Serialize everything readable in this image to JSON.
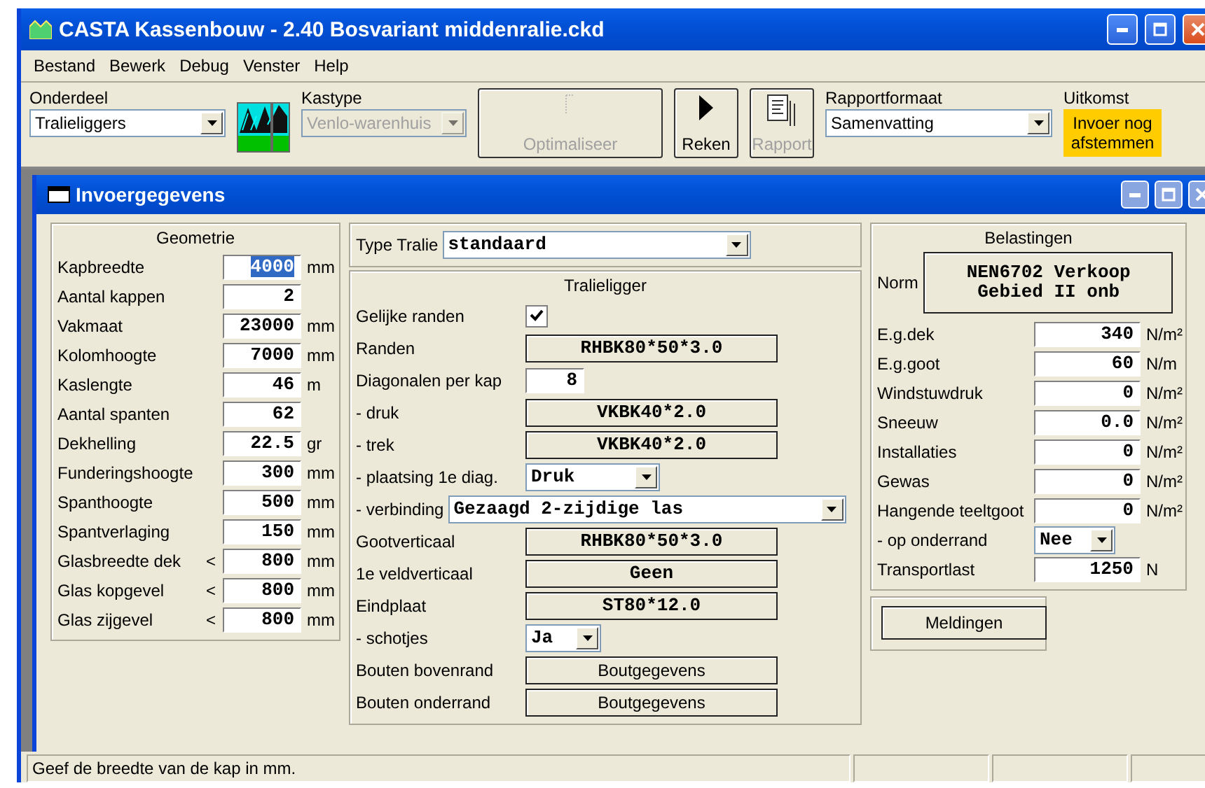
{
  "window": {
    "title": "CASTA Kassenbouw - 2.40 Bosvariant middenralie.ckd"
  },
  "menu": [
    "Bestand",
    "Bewerk",
    "Debug",
    "Venster",
    "Help"
  ],
  "toolbar": {
    "onderdeel": {
      "label": "Onderdeel",
      "value": "Tralieliggers"
    },
    "kastype": {
      "label": "Kastype",
      "value": "Venlo-warenhuis",
      "disabled": true
    },
    "buttons": [
      {
        "kind": "optimize",
        "label": "Optimaliseer",
        "disabled": true
      },
      {
        "kind": "run",
        "label": "Reken",
        "disabled": false
      },
      {
        "kind": "report",
        "label": "Rapport",
        "disabled": true
      }
    ],
    "rapportformaat": {
      "label": "Rapportformaat",
      "value": "Samenvatting"
    },
    "uitkomst": {
      "label": "Uitkomst",
      "lines": [
        "Invoer nog",
        "afstemmen"
      ],
      "color": "#ffcc00"
    }
  },
  "invoer": {
    "title": "Invoergegevens",
    "geometrie": {
      "title": "Geometrie",
      "rows": [
        {
          "label": "Kapbreedte",
          "value": "4000",
          "unit": "mm",
          "selected": true
        },
        {
          "label": "Aantal kappen",
          "value": "2",
          "selected": false
        },
        {
          "label": "Vakmaat",
          "value": "23000",
          "unit": "mm",
          "selected": false
        },
        {
          "label": "Kolomhoogte",
          "value": "7000",
          "unit": "mm",
          "selected": false
        },
        {
          "label": "Kaslengte",
          "value": "46",
          "unit": "m",
          "selected": false
        },
        {
          "label": "Aantal spanten",
          "value": "62",
          "selected": false
        },
        {
          "label": "Dekhelling",
          "value": "22.5",
          "unit": "gr",
          "selected": false
        },
        {
          "label": "Funderingshoogte",
          "value": "300",
          "unit": "mm",
          "selected": false
        },
        {
          "label": "Spanthoogte",
          "value": "500",
          "unit": "mm",
          "selected": false
        },
        {
          "label": "Spantverlaging",
          "value": "150",
          "unit": "mm",
          "selected": false
        },
        {
          "label": "Glasbreedte dek",
          "prefix": "<",
          "value": "800",
          "unit": "mm",
          "selected": false
        },
        {
          "label": "Glas kopgevel",
          "prefix": "<",
          "value": "800",
          "unit": "mm",
          "selected": false
        },
        {
          "label": "Glas zijgevel",
          "prefix": "<",
          "value": "800",
          "unit": "mm",
          "selected": false
        }
      ]
    },
    "type_tralie": {
      "label": "Type Tralie",
      "value": "standaard"
    },
    "tralieligger": {
      "title": "Tralieligger",
      "rows": [
        {
          "kind": "checkbox",
          "label": "Gelijke randen",
          "checked": true
        },
        {
          "kind": "button",
          "label": "Randen",
          "value": "RHBK80*50*3.0"
        },
        {
          "kind": "input",
          "label": "Diagonalen per kap",
          "value": "8"
        },
        {
          "kind": "button",
          "label": "- druk",
          "value": "VKBK40*2.0"
        },
        {
          "kind": "button",
          "label": "- trek",
          "value": "VKBK40*2.0"
        },
        {
          "kind": "select",
          "label": "- plaatsing 1e diag.",
          "value": "Druk"
        },
        {
          "kind": "wide_select",
          "label": "- verbinding",
          "value": "Gezaagd 2-zijdige las"
        },
        {
          "kind": "button",
          "label": "Gootverticaal",
          "value": "RHBK80*50*3.0"
        },
        {
          "kind": "button",
          "label": "1e veldverticaal",
          "value": "Geen"
        },
        {
          "kind": "button",
          "label": "Eindplaat",
          "value": "ST80*12.0"
        },
        {
          "kind": "small_select",
          "label": "- schotjes",
          "value": "Ja"
        },
        {
          "kind": "plain_button",
          "label": "Bouten bovenrand",
          "value": "Boutgegevens"
        },
        {
          "kind": "plain_button",
          "label": "Bouten onderrand",
          "value": "Boutgegevens"
        }
      ]
    },
    "belastingen": {
      "title": "Belastingen",
      "norm_label": "Norm",
      "norm_lines": [
        "NEN6702 Verkoop",
        "Gebied II onb"
      ],
      "rows": [
        {
          "kind": "input",
          "label": "E.g.dek",
          "value": "340",
          "unit": "N/m²"
        },
        {
          "kind": "input",
          "label": "E.g.goot",
          "value": "60",
          "unit": "N/m"
        },
        {
          "kind": "input",
          "label": "Windstuwdruk",
          "value": "0",
          "unit": "N/m²"
        },
        {
          "kind": "input",
          "label": "Sneeuw",
          "value": "0.0",
          "unit": "N/m²"
        },
        {
          "kind": "input",
          "label": "Installaties",
          "value": "0",
          "unit": "N/m²"
        },
        {
          "kind": "input",
          "label": "Gewas",
          "value": "0",
          "unit": "N/m²"
        },
        {
          "kind": "input",
          "label": "Hangende teeltgoot",
          "value": "0",
          "unit": "N/m²"
        },
        {
          "kind": "select",
          "label": "- op onderrand",
          "value": "Nee"
        },
        {
          "kind": "input",
          "label": "Transportlast",
          "value": "1250",
          "unit": "N"
        }
      ]
    },
    "meldingen": "Meldingen"
  },
  "status_bar": {
    "text": "Geef de breedte van de kap in mm."
  }
}
